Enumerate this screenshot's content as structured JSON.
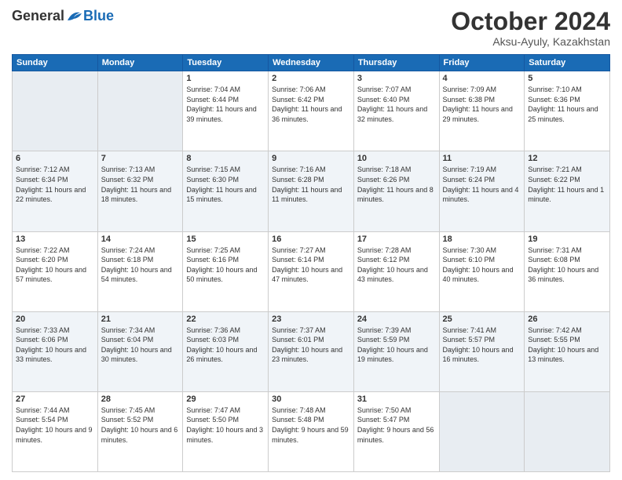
{
  "header": {
    "logo_general": "General",
    "logo_blue": "Blue",
    "month_title": "October 2024",
    "location": "Aksu-Ayuly, Kazakhstan"
  },
  "weekdays": [
    "Sunday",
    "Monday",
    "Tuesday",
    "Wednesday",
    "Thursday",
    "Friday",
    "Saturday"
  ],
  "weeks": [
    [
      {
        "day": "",
        "info": ""
      },
      {
        "day": "",
        "info": ""
      },
      {
        "day": "1",
        "info": "Sunrise: 7:04 AM\nSunset: 6:44 PM\nDaylight: 11 hours and 39 minutes."
      },
      {
        "day": "2",
        "info": "Sunrise: 7:06 AM\nSunset: 6:42 PM\nDaylight: 11 hours and 36 minutes."
      },
      {
        "day": "3",
        "info": "Sunrise: 7:07 AM\nSunset: 6:40 PM\nDaylight: 11 hours and 32 minutes."
      },
      {
        "day": "4",
        "info": "Sunrise: 7:09 AM\nSunset: 6:38 PM\nDaylight: 11 hours and 29 minutes."
      },
      {
        "day": "5",
        "info": "Sunrise: 7:10 AM\nSunset: 6:36 PM\nDaylight: 11 hours and 25 minutes."
      }
    ],
    [
      {
        "day": "6",
        "info": "Sunrise: 7:12 AM\nSunset: 6:34 PM\nDaylight: 11 hours and 22 minutes."
      },
      {
        "day": "7",
        "info": "Sunrise: 7:13 AM\nSunset: 6:32 PM\nDaylight: 11 hours and 18 minutes."
      },
      {
        "day": "8",
        "info": "Sunrise: 7:15 AM\nSunset: 6:30 PM\nDaylight: 11 hours and 15 minutes."
      },
      {
        "day": "9",
        "info": "Sunrise: 7:16 AM\nSunset: 6:28 PM\nDaylight: 11 hours and 11 minutes."
      },
      {
        "day": "10",
        "info": "Sunrise: 7:18 AM\nSunset: 6:26 PM\nDaylight: 11 hours and 8 minutes."
      },
      {
        "day": "11",
        "info": "Sunrise: 7:19 AM\nSunset: 6:24 PM\nDaylight: 11 hours and 4 minutes."
      },
      {
        "day": "12",
        "info": "Sunrise: 7:21 AM\nSunset: 6:22 PM\nDaylight: 11 hours and 1 minute."
      }
    ],
    [
      {
        "day": "13",
        "info": "Sunrise: 7:22 AM\nSunset: 6:20 PM\nDaylight: 10 hours and 57 minutes."
      },
      {
        "day": "14",
        "info": "Sunrise: 7:24 AM\nSunset: 6:18 PM\nDaylight: 10 hours and 54 minutes."
      },
      {
        "day": "15",
        "info": "Sunrise: 7:25 AM\nSunset: 6:16 PM\nDaylight: 10 hours and 50 minutes."
      },
      {
        "day": "16",
        "info": "Sunrise: 7:27 AM\nSunset: 6:14 PM\nDaylight: 10 hours and 47 minutes."
      },
      {
        "day": "17",
        "info": "Sunrise: 7:28 AM\nSunset: 6:12 PM\nDaylight: 10 hours and 43 minutes."
      },
      {
        "day": "18",
        "info": "Sunrise: 7:30 AM\nSunset: 6:10 PM\nDaylight: 10 hours and 40 minutes."
      },
      {
        "day": "19",
        "info": "Sunrise: 7:31 AM\nSunset: 6:08 PM\nDaylight: 10 hours and 36 minutes."
      }
    ],
    [
      {
        "day": "20",
        "info": "Sunrise: 7:33 AM\nSunset: 6:06 PM\nDaylight: 10 hours and 33 minutes."
      },
      {
        "day": "21",
        "info": "Sunrise: 7:34 AM\nSunset: 6:04 PM\nDaylight: 10 hours and 30 minutes."
      },
      {
        "day": "22",
        "info": "Sunrise: 7:36 AM\nSunset: 6:03 PM\nDaylight: 10 hours and 26 minutes."
      },
      {
        "day": "23",
        "info": "Sunrise: 7:37 AM\nSunset: 6:01 PM\nDaylight: 10 hours and 23 minutes."
      },
      {
        "day": "24",
        "info": "Sunrise: 7:39 AM\nSunset: 5:59 PM\nDaylight: 10 hours and 19 minutes."
      },
      {
        "day": "25",
        "info": "Sunrise: 7:41 AM\nSunset: 5:57 PM\nDaylight: 10 hours and 16 minutes."
      },
      {
        "day": "26",
        "info": "Sunrise: 7:42 AM\nSunset: 5:55 PM\nDaylight: 10 hours and 13 minutes."
      }
    ],
    [
      {
        "day": "27",
        "info": "Sunrise: 7:44 AM\nSunset: 5:54 PM\nDaylight: 10 hours and 9 minutes."
      },
      {
        "day": "28",
        "info": "Sunrise: 7:45 AM\nSunset: 5:52 PM\nDaylight: 10 hours and 6 minutes."
      },
      {
        "day": "29",
        "info": "Sunrise: 7:47 AM\nSunset: 5:50 PM\nDaylight: 10 hours and 3 minutes."
      },
      {
        "day": "30",
        "info": "Sunrise: 7:48 AM\nSunset: 5:48 PM\nDaylight: 9 hours and 59 minutes."
      },
      {
        "day": "31",
        "info": "Sunrise: 7:50 AM\nSunset: 5:47 PM\nDaylight: 9 hours and 56 minutes."
      },
      {
        "day": "",
        "info": ""
      },
      {
        "day": "",
        "info": ""
      }
    ]
  ]
}
